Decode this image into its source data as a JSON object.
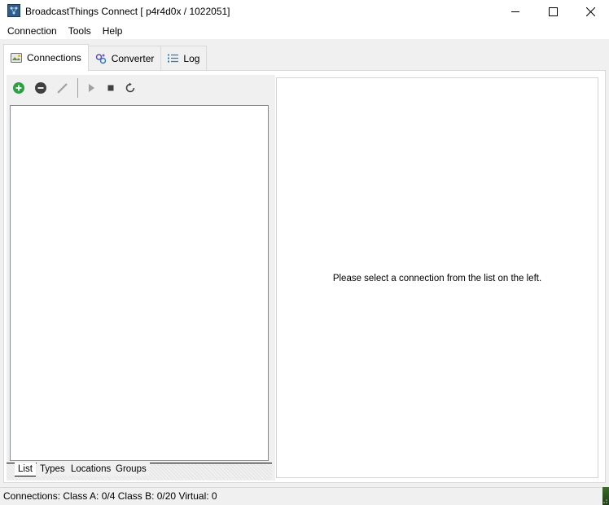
{
  "window": {
    "title": "BroadcastThings Connect [ p4r4d0x / 1022051]"
  },
  "menu": {
    "items": [
      "Connection",
      "Tools",
      "Help"
    ]
  },
  "tabs": [
    {
      "label": "Connections",
      "icon": "connections-icon",
      "active": true
    },
    {
      "label": "Converter",
      "icon": "converter-icon",
      "active": false
    },
    {
      "label": "Log",
      "icon": "log-icon",
      "active": false
    }
  ],
  "toolbar": {
    "buttons": [
      "add-icon",
      "remove-icon",
      "edit-icon",
      "play-icon",
      "stop-icon",
      "refresh-icon"
    ]
  },
  "bottom_tabs": [
    "List",
    "Types",
    "Locations",
    "Groups"
  ],
  "detail": {
    "placeholder": "Please select a connection from the list on the left."
  },
  "status": {
    "text": "Connections: Class A: 0/4 Class B: 0/20 Virtual: 0"
  },
  "colors": {
    "add": "#2ea043",
    "remove": "#404040",
    "accent": "#0078d7"
  }
}
